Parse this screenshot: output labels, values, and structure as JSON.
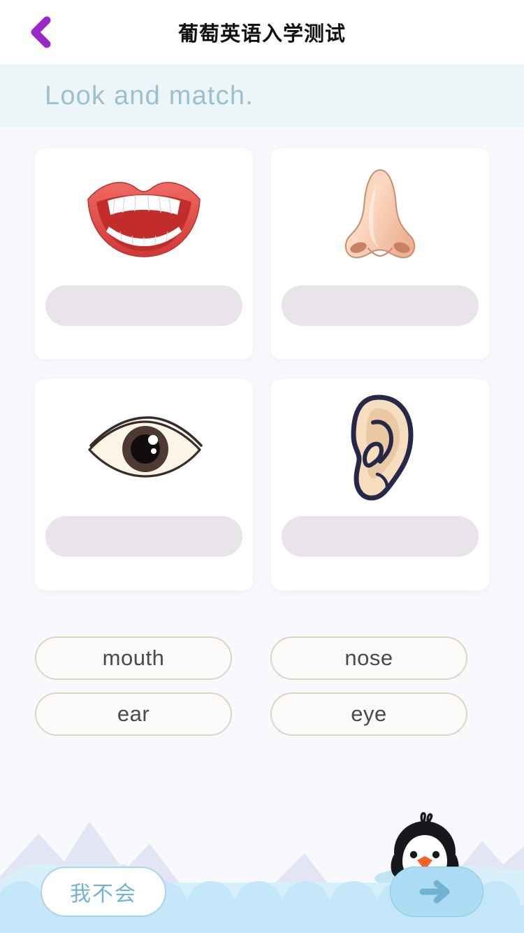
{
  "header": {
    "title": "葡萄英语入学测试",
    "back_icon": "chevron-left-icon",
    "back_color": "#9b26c9"
  },
  "instruction": {
    "text": "Look and match.",
    "text_color": "#9dc0ce",
    "band_color": "#ecf6f8"
  },
  "cards": [
    {
      "art": "mouth-illustration",
      "drop_placeholder": ""
    },
    {
      "art": "nose-illustration",
      "drop_placeholder": ""
    },
    {
      "art": "eye-illustration",
      "drop_placeholder": ""
    },
    {
      "art": "ear-illustration",
      "drop_placeholder": ""
    }
  ],
  "word_chips": [
    {
      "label": "mouth"
    },
    {
      "label": "nose"
    },
    {
      "label": "ear"
    },
    {
      "label": "eye"
    }
  ],
  "bottom": {
    "skip_label": "我不会",
    "next_icon": "arrow-right-icon",
    "mascot": "penguin-icon",
    "next_button_color": "#abdcf3",
    "skip_text_color": "#74b2d2"
  }
}
